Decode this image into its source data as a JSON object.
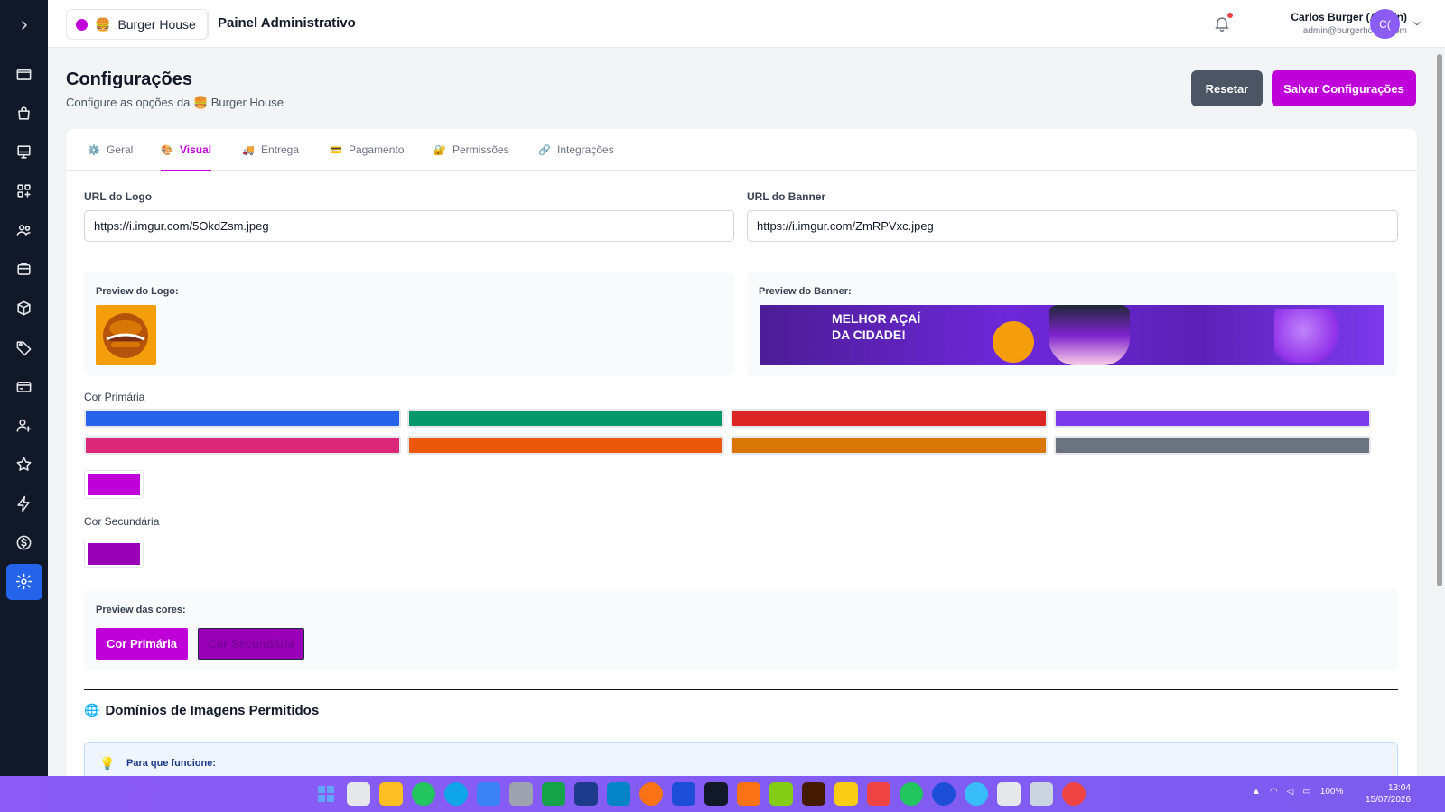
{
  "header": {
    "store_emoji": "🍔",
    "store_name": "Burger House",
    "title": "Painel Administrativo",
    "user_name": "Carlos Burger (Admin)",
    "user_email": "admin@burgerhouse.com",
    "avatar_initials": "C("
  },
  "sidebar": {
    "items": [
      "folder-icon",
      "shopping-bag-icon",
      "monitor-icon",
      "grid-plus-icon",
      "users-icon",
      "archive-icon",
      "box-icon",
      "tag-icon",
      "credit-card-icon",
      "user-plus-icon",
      "star-icon",
      "zap-icon",
      "dollar-icon",
      "settings-icon"
    ]
  },
  "page": {
    "title": "Configurações",
    "subtitle_prefix": "Configure as opções da",
    "subtitle_emoji": "🍔",
    "subtitle_store": "Burger House",
    "reset_label": "Resetar",
    "save_label": "Salvar Configurações"
  },
  "tabs": [
    {
      "icon": "⚙️",
      "label": "Geral"
    },
    {
      "icon": "🎨",
      "label": "Visual"
    },
    {
      "icon": "🚚",
      "label": "Entrega"
    },
    {
      "icon": "💳",
      "label": "Pagamento"
    },
    {
      "icon": "🔐",
      "label": "Permissões"
    },
    {
      "icon": "🔗",
      "label": "Integrações"
    }
  ],
  "visual": {
    "logo_label": "URL do Logo",
    "logo_url": "https://i.imgur.com/5OkdZsm.jpeg",
    "banner_label": "URL do Banner",
    "banner_url": "https://i.imgur.com/ZmRPVxc.jpeg",
    "logo_preview_label": "Preview do Logo:",
    "banner_preview_label": "Preview do Banner:",
    "banner_headline_1": "MELHOR AÇAÍ",
    "banner_headline_2": "DA CIDADE!",
    "primary_label": "Cor Primária",
    "secondary_label": "Cor Secundária",
    "primary_palette": [
      "#2563eb",
      "#059669",
      "#dc2626",
      "#7c3aed",
      "#db2777",
      "#ea580c",
      "#d97706",
      "#6b7280"
    ],
    "primary_selected": "#c000d8",
    "secondary_selected": "#9900b8",
    "colors_preview_label": "Preview das cores:",
    "primary_button_label": "Cor Primária",
    "secondary_button_label": "Cor Secundária"
  },
  "domains": {
    "globe_icon": "🌐",
    "title": "Domínios de Imagens Permitidos",
    "info_icon": "💡",
    "info_text": "Para que funcione:"
  },
  "taskbar": {
    "time": "13:04",
    "date": "15/07/2026",
    "battery": "100%"
  }
}
